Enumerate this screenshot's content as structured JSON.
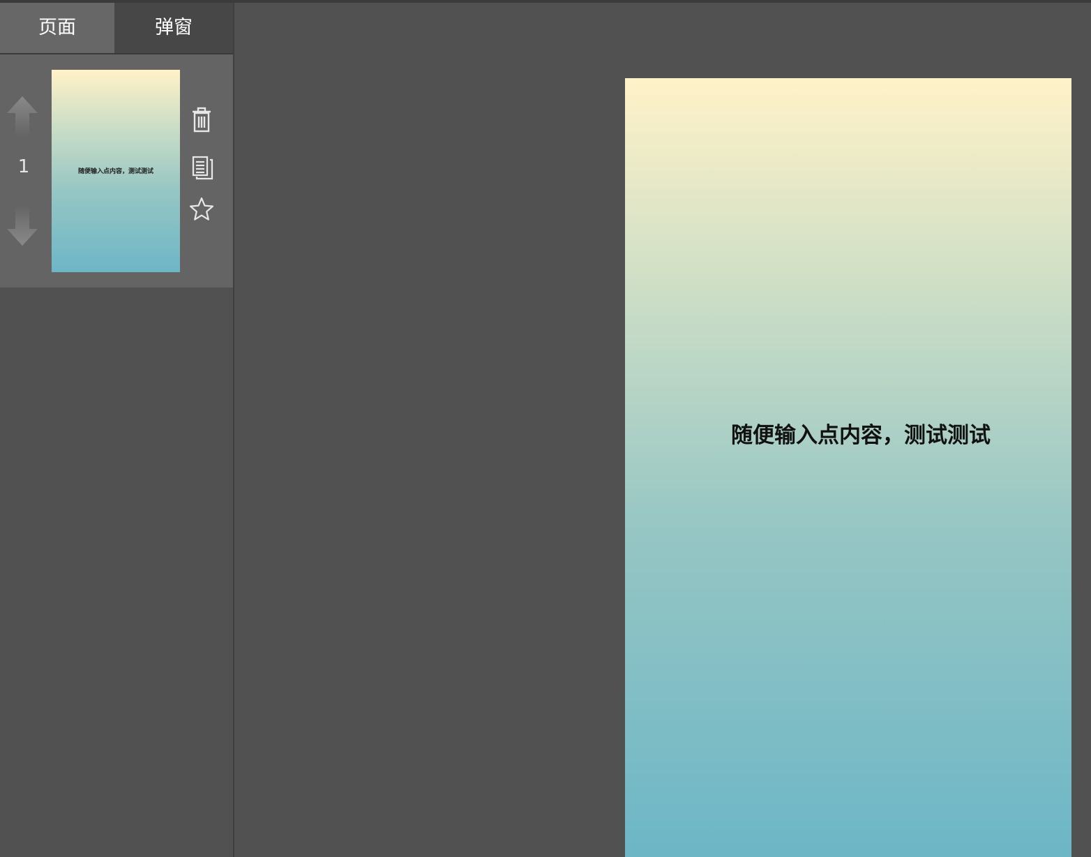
{
  "tabs": [
    {
      "label": "页面",
      "active": true
    },
    {
      "label": "弹窗",
      "active": false
    }
  ],
  "pages": [
    {
      "number": "1",
      "text": "随便输入点内容，测试测试",
      "actions": [
        "trash-icon",
        "copy-icon",
        "star-icon"
      ]
    }
  ],
  "canvas": {
    "text": "随便输入点内容，测试测试"
  },
  "colors": {
    "background": "#515151",
    "tab_active": "#676767",
    "tab_inactive": "#474747",
    "page_entry": "#646464",
    "gradient_top": "#fff2c8",
    "gradient_bottom": "#6db6c6"
  },
  "icons": [
    "arrow-up-icon",
    "arrow-down-icon",
    "trash-icon",
    "copy-icon",
    "star-icon"
  ]
}
